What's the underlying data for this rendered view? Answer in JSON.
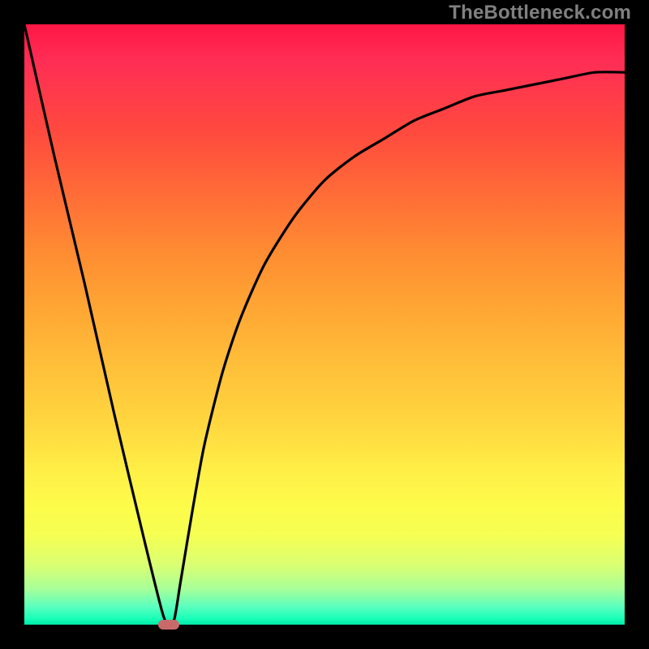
{
  "watermark": "TheBottleneck.com",
  "chart_data": {
    "type": "line",
    "title": "",
    "xlabel": "",
    "ylabel": "",
    "xlim": [
      0,
      100
    ],
    "ylim": [
      0,
      100
    ],
    "grid": false,
    "legend": false,
    "series": [
      {
        "name": "bottleneck-curve",
        "x": [
          0,
          5,
          10,
          15,
          20,
          23,
          24,
          25,
          26,
          28,
          30,
          33,
          36,
          40,
          45,
          50,
          55,
          60,
          65,
          70,
          75,
          80,
          85,
          90,
          95,
          100
        ],
        "y": [
          100,
          78,
          57,
          35,
          14,
          2,
          0,
          1,
          7,
          19,
          30,
          42,
          51,
          60,
          68,
          74,
          78,
          81,
          84,
          86,
          88,
          89,
          90,
          91,
          92,
          92
        ]
      }
    ],
    "annotations": [
      {
        "name": "min-marker",
        "x": 24,
        "y": 0
      }
    ],
    "colors": {
      "curve": "#000000",
      "frame": "#000000",
      "marker": "#c96a6a",
      "gradient_top": "#ff1744",
      "gradient_bottom": "#00e8a8"
    }
  }
}
